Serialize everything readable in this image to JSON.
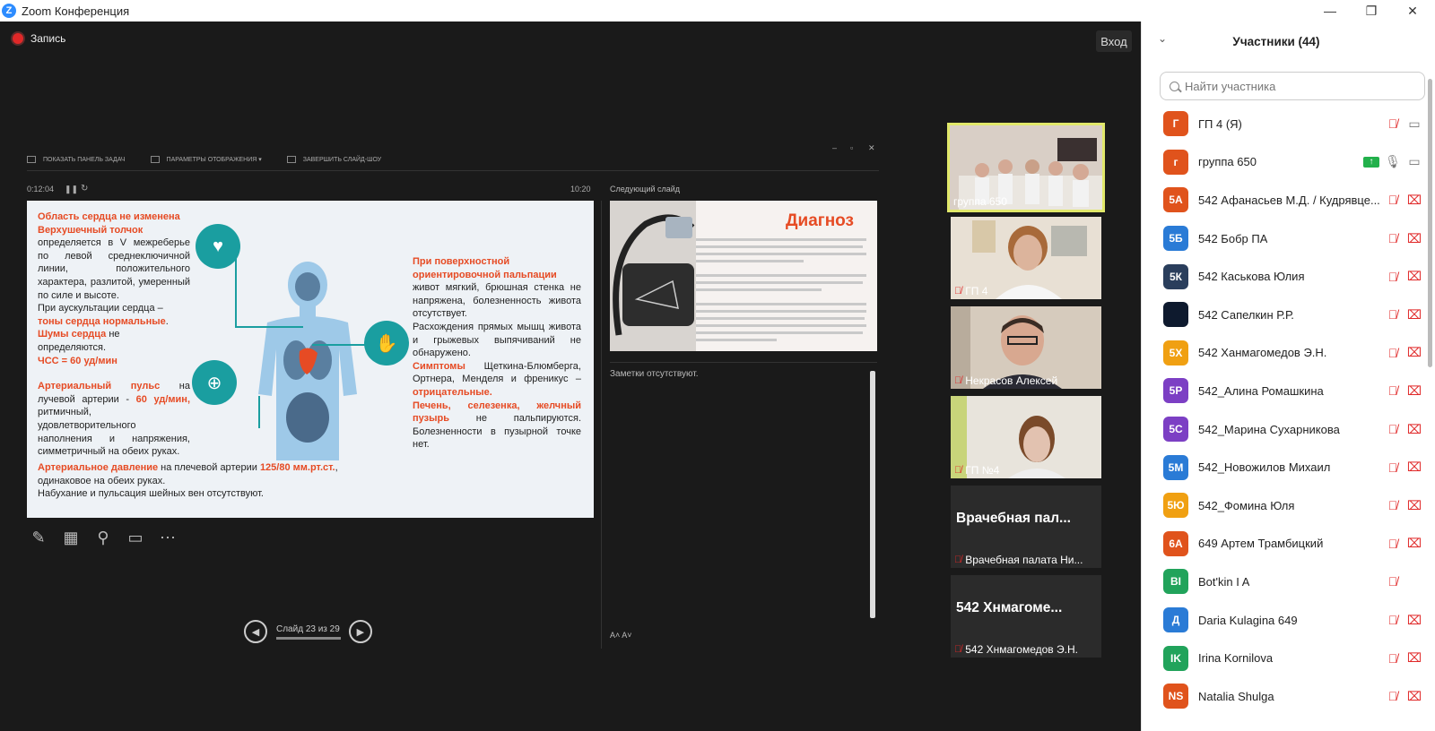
{
  "app": {
    "title": "Zoom Конференция",
    "logo": "Z"
  },
  "window": {
    "minimize": "—",
    "maximize": "❐",
    "close": "✕"
  },
  "meeting": {
    "record_label": "Запись",
    "exit_label": "Вход"
  },
  "presenter": {
    "toolbar": [
      "ПОКАЗАТЬ ПАНЕЛЬ ЗАДАЧ",
      "ПАРАМЕТРЫ ОТОБРАЖЕНИЯ ▾",
      "ЗАВЕРШИТЬ СЛАЙД-ШОУ"
    ],
    "elapsed": "0:12:04",
    "clock": "10:20",
    "next_label": "Следующий слайд",
    "notes": "Заметки отсутствуют.",
    "slide_counter": "Слайд 23 из 29",
    "font_tools": "A˄  A˅"
  },
  "slide": {
    "l1": "Область сердца не изменена",
    "l2": "Верхушечный толчок",
    "l3": "определяется в V межреберье по левой среднеключичной линии, положительного характера, разлитой, умеренный по силе и высоте.",
    "l4a": "При аускультации сердца – ",
    "l4b": "тоны сердца нормальные",
    "l5a": "Шумы сердца",
    "l5b": " не определяются.",
    "l6": "ЧСС = 60 уд/мин",
    "l7a": "Артериальный пульс",
    "l7b": " на лучевой артерии - ",
    "l7c": "60 уд/мин,",
    "l7d": " ритмичный, удовлетворительного наполнения и напряжения, симметричный на обеих руках.",
    "l8a": "Артериальное давление",
    "l8b": " на плечевой артерии ",
    "l8c": "125/80 мм.рт.ст.",
    "l8d": ", одинаковое на обеих руках.",
    "l9": "Набухание и пульсация шейных вен отсутствуют.",
    "r1": "При поверхностной ориентировочной пальпации",
    "r2": "живот мягкий, брюшная стенка не напряжена, болезненность живота отсутствует.",
    "r3": "Расхождения прямых мышц живота и грыжевых выпячиваний не обнаружено.",
    "r4a": "Симптомы",
    "r4b": " Щеткина-Блюмберга, Ортнера, Менделя и френикус – ",
    "r4c": "отрицательные.",
    "r5a": "Печень, селезенка, желчный пузырь",
    "r5b": " не пальпируются. Болезненности в пузырной точке нет."
  },
  "next_slide": {
    "title": "Диагноз"
  },
  "videos": [
    {
      "name": "группа 650",
      "active": true,
      "muted": false
    },
    {
      "name": "ГП 4",
      "muted": true
    },
    {
      "name": "Некрасов Алексей",
      "muted": true
    },
    {
      "name": "ГП №4",
      "muted": true
    },
    {
      "name": "Врачебная палата Ни...",
      "big": "Врачебная пал...",
      "muted": true
    },
    {
      "name": "542 Хнмагомедов Э.Н.",
      "big": "542 Хнмагоме...",
      "muted": true
    }
  ],
  "panel": {
    "title": "Участники (44)",
    "search_placeholder": "Найти участника",
    "participants": [
      {
        "initials": "Г",
        "color": "#e0531c",
        "name": "ГП 4 (Я)",
        "audio": "muted",
        "video": "on"
      },
      {
        "initials": "г",
        "color": "#e0531c",
        "name": "группа 650",
        "audio": "on",
        "video": "on",
        "sharing": true
      },
      {
        "initials": "5А",
        "color": "#e0531c",
        "name": "542 Афанасьев М.Д. / Кудрявце...",
        "audio": "muted",
        "video": "off"
      },
      {
        "initials": "5Б",
        "color": "#2a7bd6",
        "name": "542 Бобр ПА",
        "audio": "muted",
        "video": "off"
      },
      {
        "initials": "5К",
        "color": "#2a3e5c",
        "name": "542 Каськова Юлия",
        "audio": "muted",
        "video": "off"
      },
      {
        "initials": "",
        "color": "#0e1a2e",
        "name": "542 Сапелкин Р.Р.",
        "audio": "muted",
        "video": "off"
      },
      {
        "initials": "5Х",
        "color": "#f0a012",
        "name": "542 Ханмагомедов Э.Н.",
        "audio": "muted",
        "video": "off"
      },
      {
        "initials": "5Р",
        "color": "#7c3fc4",
        "name": "542_Алина Ромашкина",
        "audio": "muted",
        "video": "off"
      },
      {
        "initials": "5С",
        "color": "#7c3fc4",
        "name": "542_Марина Сухарникова",
        "audio": "muted",
        "video": "off"
      },
      {
        "initials": "5М",
        "color": "#2a7bd6",
        "name": "542_Новожилов Михаил",
        "audio": "muted",
        "video": "off"
      },
      {
        "initials": "5Ю",
        "color": "#f0a012",
        "name": "542_Фомина Юля",
        "audio": "muted",
        "video": "off"
      },
      {
        "initials": "6А",
        "color": "#e0531c",
        "name": "649 Артем Трамбицкий",
        "audio": "muted",
        "video": "off"
      },
      {
        "initials": "BI",
        "color": "#21a35b",
        "name": "Bot'kin I A",
        "audio": "muted",
        "video": "none"
      },
      {
        "initials": "Д",
        "color": "#2a7bd6",
        "name": "Daria Kulagina 649",
        "audio": "muted",
        "video": "off"
      },
      {
        "initials": "IK",
        "color": "#21a35b",
        "name": "Irina Kornilova",
        "audio": "muted",
        "video": "off"
      },
      {
        "initials": "NS",
        "color": "#e0531c",
        "name": "Natalia Shulga",
        "audio": "muted",
        "video": "off"
      }
    ]
  }
}
